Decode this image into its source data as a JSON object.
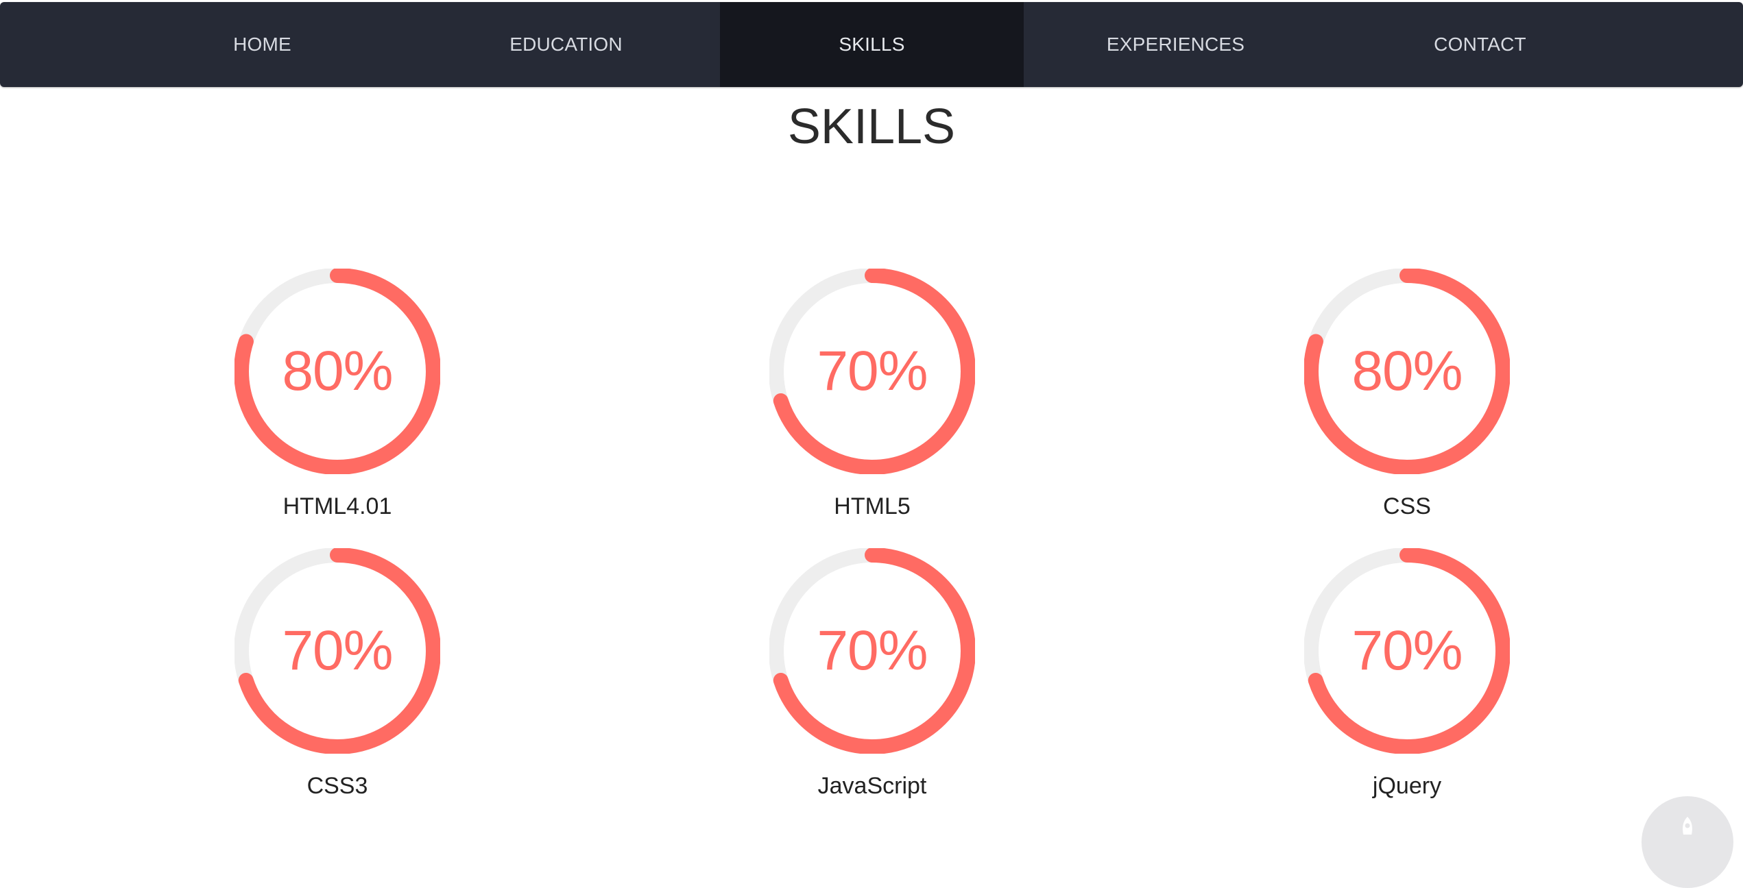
{
  "nav": {
    "items": [
      {
        "label": "HOME",
        "active": false
      },
      {
        "label": "EDUCATION",
        "active": false
      },
      {
        "label": "SKILLS",
        "active": true
      },
      {
        "label": "EXPERIENCES",
        "active": false
      },
      {
        "label": "CONTACT",
        "active": false
      }
    ]
  },
  "page": {
    "title": "SKILLS"
  },
  "skills": [
    {
      "name": "HTML4.01",
      "percent_label": "80%",
      "percent": 80
    },
    {
      "name": "HTML5",
      "percent_label": "70%",
      "percent": 70
    },
    {
      "name": "CSS",
      "percent_label": "80%",
      "percent": 80
    },
    {
      "name": "CSS3",
      "percent_label": "70%",
      "percent": 70
    },
    {
      "name": "JavaScript",
      "percent_label": "70%",
      "percent": 70
    },
    {
      "name": "jQuery",
      "percent_label": "70%",
      "percent": 70
    }
  ],
  "colors": {
    "nav_bg": "#262a36",
    "nav_active_bg": "#15171e",
    "accent": "#ff6b63",
    "ring_track": "#eeeeee"
  },
  "icons": {
    "scroll_top": "rocket-icon"
  }
}
